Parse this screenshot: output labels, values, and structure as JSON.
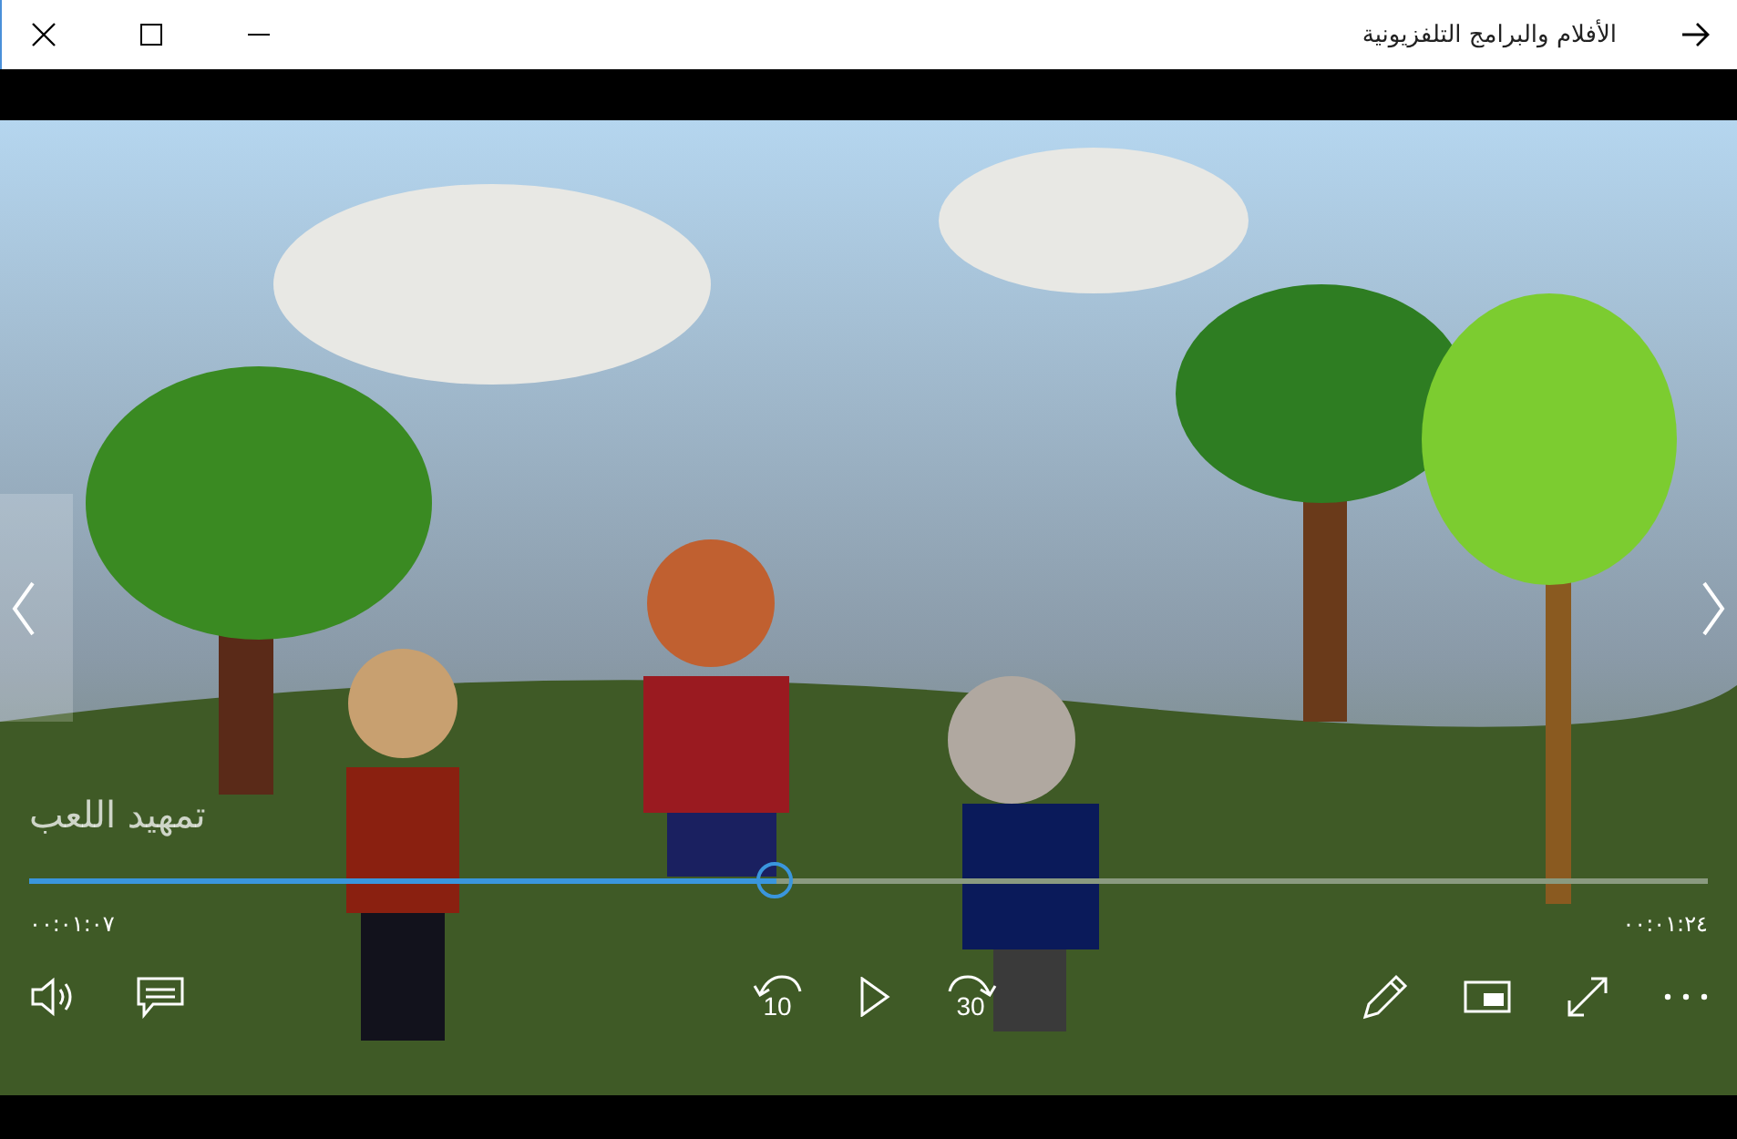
{
  "window": {
    "title": "الأفلام والبرامج التلفزيونية"
  },
  "player": {
    "video_title": "تمهيد اللعب",
    "elapsed": "٠٠:٠١:٠٧",
    "remaining": "٠٠:٠١:٢٤",
    "level": 0.445,
    "skip_back": "10",
    "skip_forward": "30"
  }
}
